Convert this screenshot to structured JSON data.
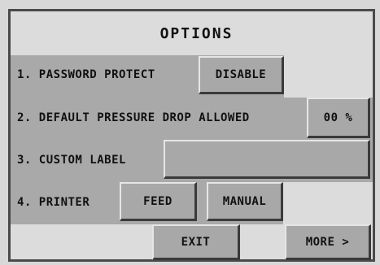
{
  "title": "OPTIONS",
  "rows": {
    "password": {
      "label": "1. PASSWORD PROTECT",
      "button": "DISABLE"
    },
    "pressure": {
      "label": "2. DEFAULT PRESSURE DROP ALLOWED",
      "value": "00 %"
    },
    "custom_label": {
      "label": "3. CUSTOM LABEL",
      "value": ""
    },
    "printer": {
      "label": "4. PRINTER",
      "feed_button": "FEED",
      "manual_button": "MANUAL"
    }
  },
  "footer": {
    "exit_button": "EXIT",
    "more_button": "MORE >"
  },
  "colors": {
    "panel_gray": "#a9a9a9",
    "light_gray": "#dcdcdc",
    "border_dark": "#3a3a3a",
    "highlight": "#e6e6e6"
  }
}
